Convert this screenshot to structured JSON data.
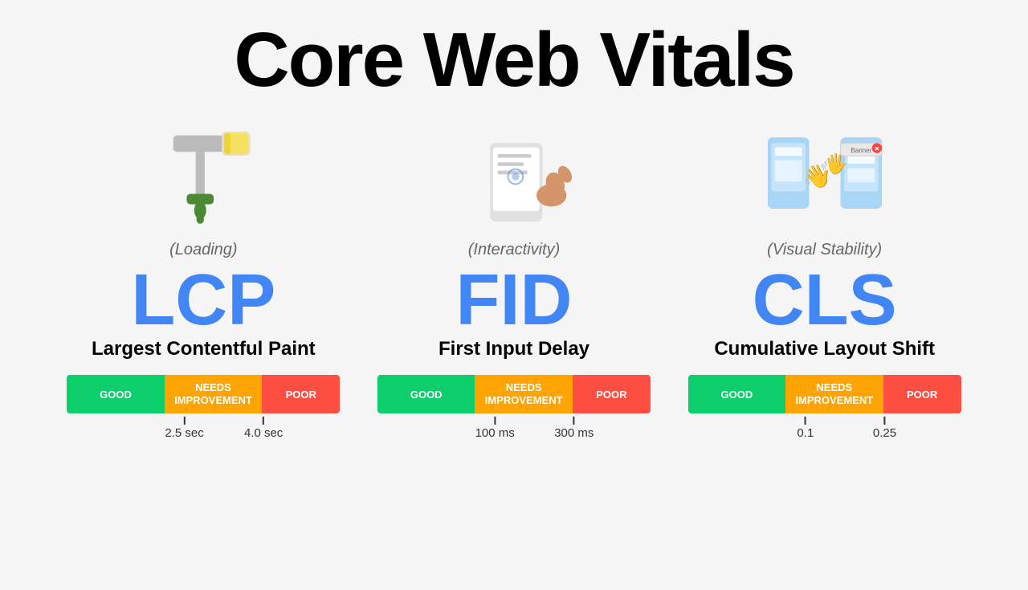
{
  "page": {
    "title": "Core Web Vitals"
  },
  "vitals": [
    {
      "id": "lcp",
      "icon": "paint-roller",
      "category": "(Loading)",
      "acronym": "LCP",
      "name": "Largest Contentful Paint",
      "scale": {
        "good_label": "GOOD",
        "needs_label": "NEEDS\nIMPROVEMENT",
        "poor_label": "POOR"
      },
      "markers": [
        {
          "value": "2.5 sec",
          "position": "43"
        },
        {
          "value": "4.0 sec",
          "position": "72"
        }
      ]
    },
    {
      "id": "fid",
      "icon": "phone-tap",
      "category": "(Interactivity)",
      "acronym": "FID",
      "name": "First Input Delay",
      "scale": {
        "good_label": "GOOD",
        "needs_label": "NEEDS\nIMPROVEMENT",
        "poor_label": "POOR"
      },
      "markers": [
        {
          "value": "100 ms",
          "position": "43"
        },
        {
          "value": "300 ms",
          "position": "72"
        }
      ]
    },
    {
      "id": "cls",
      "icon": "layout-shift",
      "category": "(Visual Stability)",
      "acronym": "CLS",
      "name": "Cumulative Layout Shift",
      "scale": {
        "good_label": "GOOD",
        "needs_label": "NEEDS\nIMPROVEMENT",
        "poor_label": "POOR"
      },
      "markers": [
        {
          "value": "0.1",
          "position": "43"
        },
        {
          "value": "0.25",
          "position": "72"
        }
      ]
    }
  ]
}
